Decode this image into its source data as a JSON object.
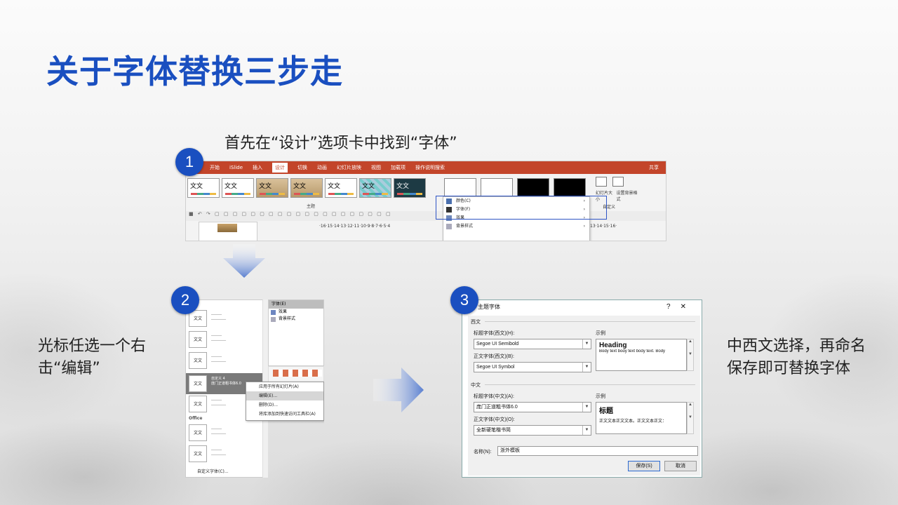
{
  "slide": {
    "title": "关于字体替换三步走",
    "step1_caption": "首先在“设计”选项卡中找到“字体”",
    "step2_caption": "光标任选一个右击“编辑”",
    "step3_caption": "中西文选择，再命名保存即可替换字体",
    "step_numbers": [
      "1",
      "2",
      "3"
    ],
    "accent_color": "#1a4fc0"
  },
  "shot1": {
    "tabs": [
      "开始",
      "iSlide",
      "插入",
      "设计",
      "切换",
      "动画",
      "幻灯片放映",
      "视图",
      "加载项",
      "操作说明搜索"
    ],
    "active_tab": "设计",
    "share": "共享",
    "theme_thumb_text": "文文",
    "theme_group_label": "主题",
    "customize_label": "幻灯片大小",
    "format_bg_label": "设置背景格式",
    "customize_group": "自定义",
    "ruler_left": "·16·15·14·13·12·11·10·9·8·7·6·5·4",
    "ruler_right": "13·14·15·16·",
    "menu": {
      "colors": "颜色(C)",
      "fonts": "字体(F)",
      "effects": "效果",
      "bg_styles": "背景样式"
    }
  },
  "shot2": {
    "theme_thumb_text": "文文",
    "selected_name": "自定义 4",
    "selected_preview": "庞门正道粗书体6.0",
    "office_label": "Office",
    "custom_fonts": "自定义字体(C)...",
    "right_header": "字体(E)",
    "right_effects": "效果",
    "right_bg": "背景样式",
    "ctx": {
      "apply_all": "应用于所有幻灯片(A)",
      "edit": "编辑(E)...",
      "delete": "删除(D)...",
      "add_qat": "将库添加到快速访问工具栏(A)"
    }
  },
  "dialog": {
    "title": "主题字体",
    "help": "?",
    "close": "✕",
    "western": "西文",
    "heading_west_label": "标题字体(西文)(H):",
    "heading_west_value": "Segoe UI Semibold",
    "body_west_label": "正文字体(西文)(B):",
    "body_west_value": "Segoe UI Symbol",
    "sample_label": "示例",
    "sample_heading": "Heading",
    "sample_body": "Body text body text body text. Body",
    "chinese": "中文",
    "heading_cn_label": "标题字体(中文)(A):",
    "heading_cn_value": "庞门正道粗书体6.0",
    "body_cn_label": "正文字体(中文)(O):",
    "body_cn_value": "全新硬笔楷书简",
    "sample_cn_heading": "标题",
    "sample_cn_body": "正文文本正文文本。正文文本正文：",
    "name_label": "名称(N):",
    "name_value": "浙外模板",
    "save": "保存(S)",
    "cancel": "取消"
  }
}
